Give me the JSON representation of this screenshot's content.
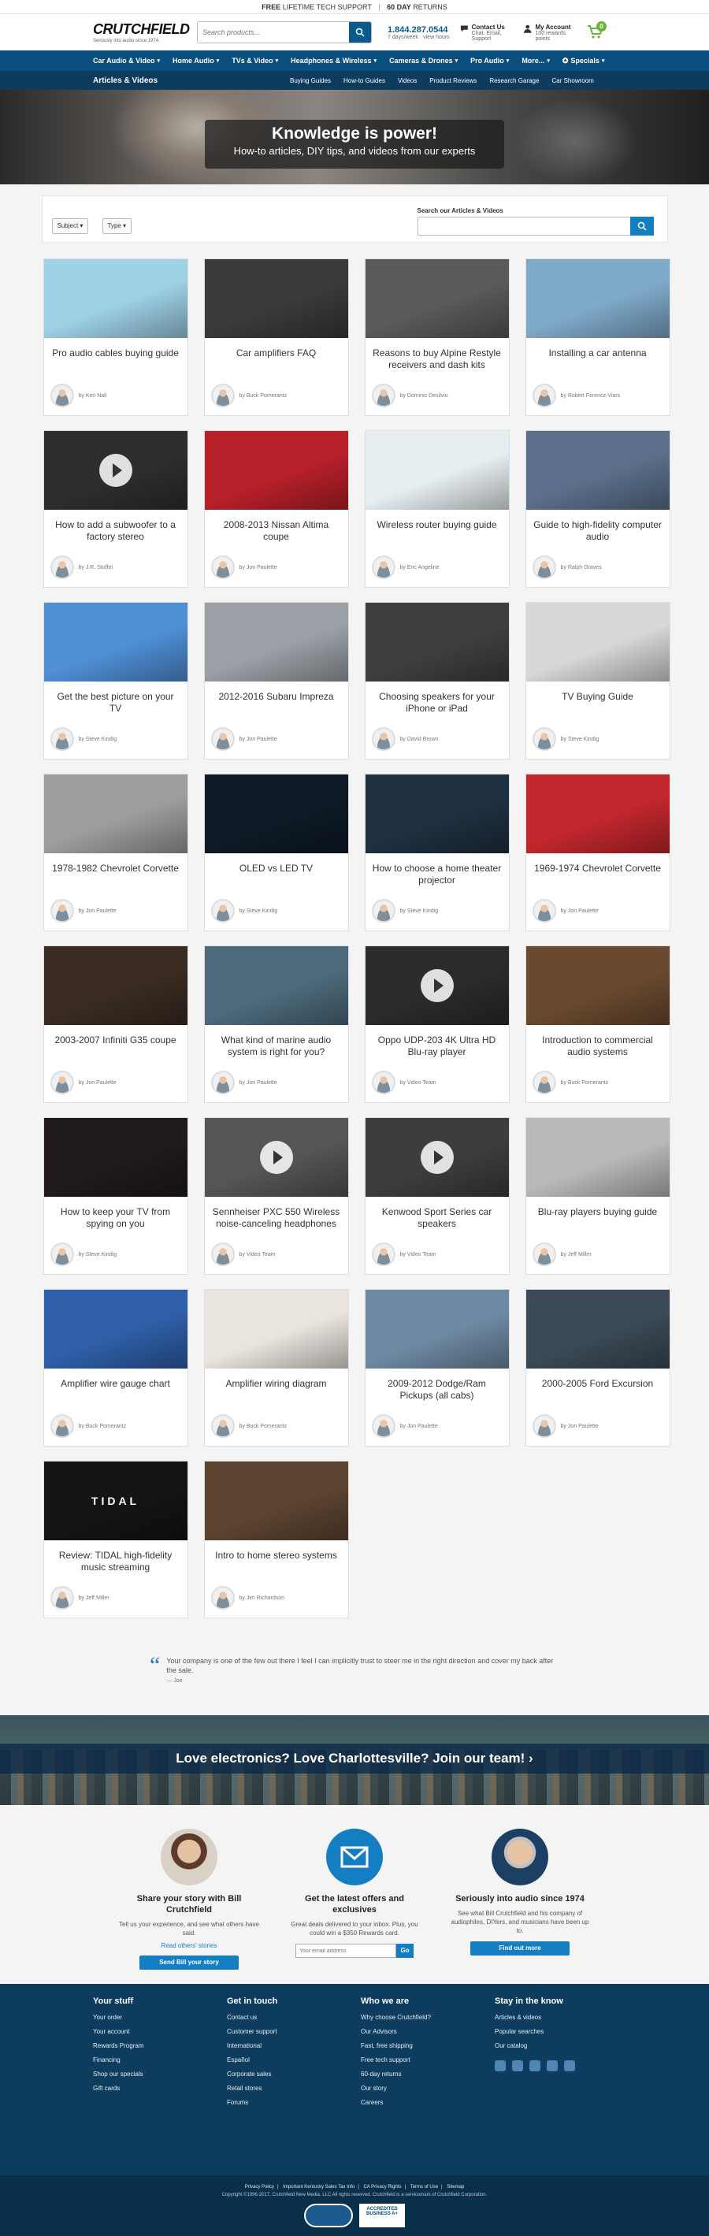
{
  "promo": {
    "free": "FREE",
    "lifetime": "LIFETIME TECH SUPPORT",
    "days": "60 DAY",
    "returns": "RETURNS"
  },
  "header": {
    "logo": "CRUTCHFIELD",
    "tagline": "Seriously into audio since 1974.",
    "search_placeholder": "Search products...",
    "phone": "1.844.287.0544",
    "phone_sub": "7 days/week · view hours",
    "contact_title": "Contact Us",
    "contact_sub": "Chat, Email, Support",
    "account_title": "My Account",
    "account_sub": "100 rewards points",
    "cart_count": "0"
  },
  "nav": [
    "Car Audio & Video",
    "Home Audio",
    "TVs & Video",
    "Headphones & Wireless",
    "Cameras & Drones",
    "Pro Audio",
    "More...",
    "Specials"
  ],
  "subnav": {
    "section": "Articles & Videos",
    "links": [
      "Buying Guides",
      "How-to Guides",
      "Videos",
      "Product Reviews",
      "Research Garage",
      "Car Showroom"
    ]
  },
  "hero": {
    "title": "Knowledge is power!",
    "subtitle": "How-to articles, DIY tips, and videos from our experts"
  },
  "filters": {
    "subject": "Subject",
    "type": "Type",
    "search_label": "Search our Articles & Videos"
  },
  "cards": [
    {
      "title": "Pro audio cables buying guide",
      "author": "by Ken Nail",
      "video": false
    },
    {
      "title": "Car amplifiers FAQ",
      "author": "by Buck Pomerantz",
      "video": false
    },
    {
      "title": "Reasons to buy Alpine Restyle receivers and dash kits",
      "author": "by Dominic Desilvio",
      "video": false
    },
    {
      "title": "Installing a car antenna",
      "author": "by Robert Ferencz-Viars",
      "video": false
    },
    {
      "title": "How to add a subwoofer to a factory stereo",
      "author": "by J.R. Stoffel",
      "video": true
    },
    {
      "title": "2008-2013 Nissan Altima coupe",
      "author": "by Jon Paulette",
      "video": false
    },
    {
      "title": "Wireless router buying guide",
      "author": "by Eric Angeline",
      "video": false
    },
    {
      "title": "Guide to high-fidelity computer audio",
      "author": "by Ralph Graves",
      "video": false
    },
    {
      "title": "Get the best picture on your TV",
      "author": "by Steve Kindig",
      "video": false
    },
    {
      "title": "2012-2016 Subaru Impreza",
      "author": "by Jon Paulette",
      "video": false
    },
    {
      "title": "Choosing speakers for your iPhone or iPad",
      "author": "by David Brown",
      "video": false
    },
    {
      "title": "TV Buying Guide",
      "author": "by Steve Kindig",
      "video": false
    },
    {
      "title": "1978-1982 Chevrolet Corvette",
      "author": "by Jon Paulette",
      "video": false
    },
    {
      "title": "OLED vs LED TV",
      "author": "by Steve Kindig",
      "video": false
    },
    {
      "title": "How to choose a home theater projector",
      "author": "by Steve Kindig",
      "video": false
    },
    {
      "title": "1969-1974 Chevrolet Corvette",
      "author": "by Jon Paulette",
      "video": false
    },
    {
      "title": "2003-2007 Infiniti G35 coupe",
      "author": "by Jon Paulette",
      "video": false
    },
    {
      "title": "What kind of marine audio system is right for you?",
      "author": "by Jon Paulette",
      "video": false
    },
    {
      "title": "Oppo UDP-203 4K Ultra HD Blu-ray player",
      "author": "by Video Team",
      "video": true
    },
    {
      "title": "Introduction to commercial audio systems",
      "author": "by Buck Pomerantz",
      "video": false
    },
    {
      "title": "How to keep your TV from spying on you",
      "author": "by Steve Kindig",
      "video": false
    },
    {
      "title": "Sennheiser PXC 550 Wireless noise-canceling headphones",
      "author": "by Video Team",
      "video": true
    },
    {
      "title": "Kenwood Sport Series car speakers",
      "author": "by Video Team",
      "video": true
    },
    {
      "title": "Blu-ray players buying guide",
      "author": "by Jeff Miller",
      "video": false
    },
    {
      "title": "Amplifier wire gauge chart",
      "author": "by Buck Pomerantz",
      "video": false
    },
    {
      "title": "Amplifier wiring diagram",
      "author": "by Buck Pomerantz",
      "video": false
    },
    {
      "title": "2009-2012 Dodge/Ram Pickups (all cabs)",
      "author": "by Jon Paulette",
      "video": false
    },
    {
      "title": "2000-2005 Ford Excursion",
      "author": "by Jon Paulette",
      "video": false
    },
    {
      "title": "Review: TIDAL high-fidelity music streaming",
      "author": "by Jeff Miller",
      "video": false,
      "tag": "TIDAL"
    },
    {
      "title": "Intro to home stereo systems",
      "author": "by Jim Richardson",
      "video": false
    }
  ],
  "thumb_colors": [
    "#9ed0e6",
    "#3a3a3a",
    "#5a5a5a",
    "#7fa9c9",
    "#2e2e2e",
    "#b8202a",
    "#e7eef2",
    "#5b6f8a",
    "#4f8fd6",
    "#9aa0a6",
    "#3f3f3f",
    "#d8d8d8",
    "#9d9d9d",
    "#0e1a26",
    "#1f3040",
    "#c1272d",
    "#3a2c22",
    "#4d6b7c",
    "#2b2b2b",
    "#6a4a2f",
    "#201a1a",
    "#555555",
    "#3d3d3d",
    "#b9b9b9",
    "#2f5fa8",
    "#e9e4de",
    "#6e8aa3",
    "#3b4a56",
    "#141414",
    "#5d4431"
  ],
  "testimonial": {
    "text": "Your company is one of the few out there I feel I can implicitly trust to steer me in the right direction and cover my back after the sale.",
    "by": "— Joe"
  },
  "careers": {
    "text": "Love electronics? Love Charlottesville? Join our team!  ›"
  },
  "bottom": [
    {
      "title": "Share your story with Bill Crutchfield",
      "text": "Tell us your experience, and see what others have said.",
      "link": "Read others' stories",
      "button": "Send Bill your story"
    },
    {
      "title": "Get the latest offers and exclusives",
      "text": "Great deals delivered to your inbox. Plus, you could win a $350 Rewards card.",
      "placeholder": "Your email address",
      "button": "Go"
    },
    {
      "title": "Seriously into audio since 1974",
      "text": "See what Bill Crutchfield and his company of audiophiles, DIYers, and musicians have been up to.",
      "button": "Find out more"
    }
  ],
  "footer": {
    "cols": [
      {
        "title": "Your stuff",
        "links": [
          "Your order",
          "Your account",
          "Rewards Program",
          "Financing",
          "Shop our specials",
          "Gift cards"
        ]
      },
      {
        "title": "Get in touch",
        "links": [
          "Contact us",
          "Customer support",
          "International",
          "Español",
          "Corporate sales",
          "Retail stores",
          "Forums"
        ]
      },
      {
        "title": "Who we are",
        "links": [
          "Why choose Crutchfield?",
          "Our Advisors",
          "Fast, free shipping",
          "Free tech support",
          "60-day returns",
          "Our story",
          "Careers"
        ]
      },
      {
        "title": "Stay in the know",
        "links": [
          "Articles & videos",
          "Popular searches",
          "Our catalog"
        ]
      }
    ],
    "legal": [
      "Privacy Policy",
      "Important Kentucky Sales Tax Info",
      "CA Privacy Rights",
      "Terms of Use",
      "Sitemap"
    ],
    "copyright": "Copyright ©1996-2017, Crutchfield New Media, LLC All rights reserved. Crutchfield is a servicemark of Crutchfield Corporation.",
    "bbb": "ACCREDITED BUSINESS A+"
  }
}
